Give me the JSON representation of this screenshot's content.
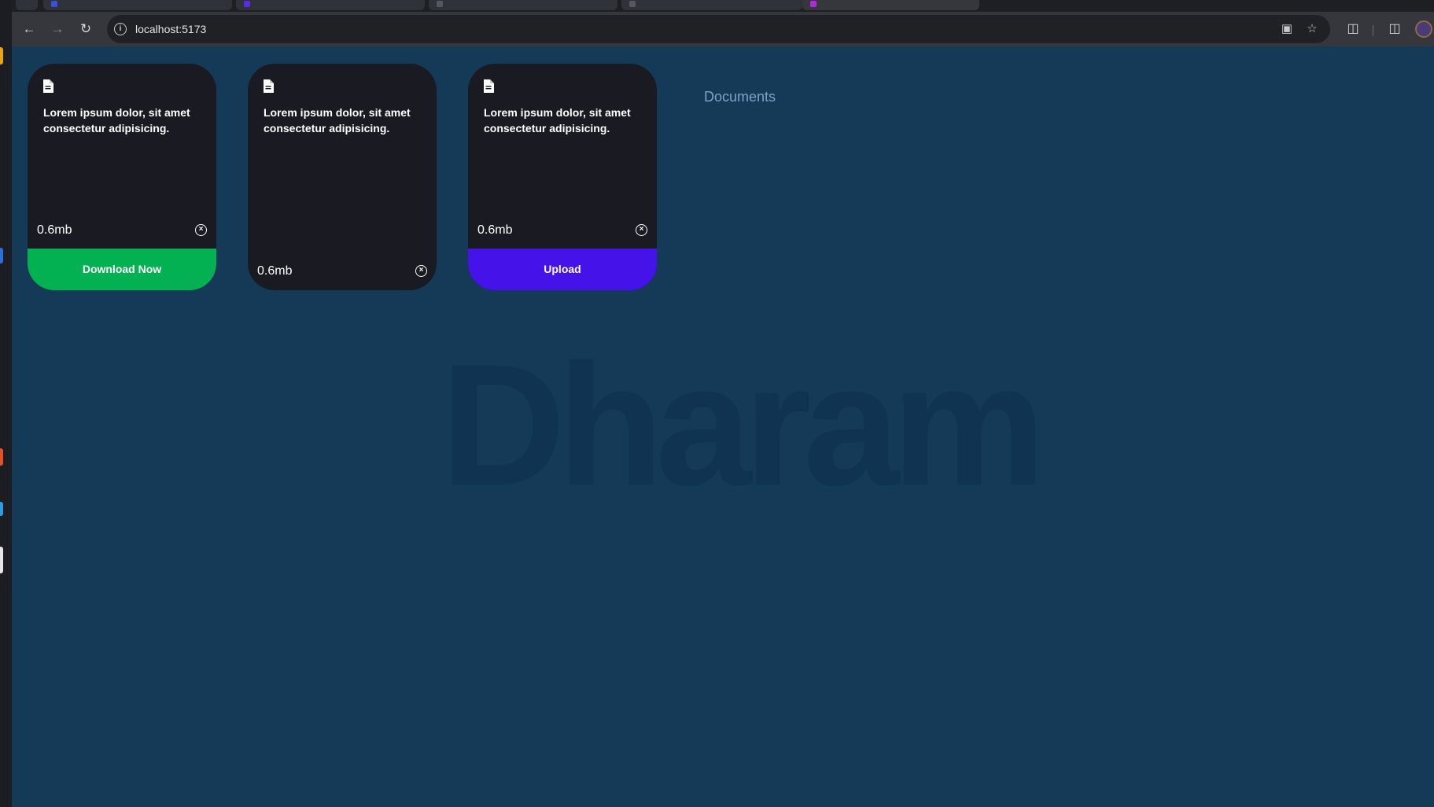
{
  "browser": {
    "url": "localhost:5173"
  },
  "page": {
    "documents_label": "Documents",
    "watermark": "Dharam"
  },
  "cards": [
    {
      "title": "Lorem ipsum dolor, sit amet consectetur adipisicing.",
      "size": "0.6mb",
      "action_label": "Download Now",
      "action_color": "#03b152"
    },
    {
      "title": "Lorem ipsum dolor, sit amet consectetur adipisicing.",
      "size": "0.6mb"
    },
    {
      "title": "Lorem ipsum dolor, sit amet consectetur adipisicing.",
      "size": "0.6mb",
      "action_label": "Upload",
      "action_color": "#4512ea"
    }
  ],
  "icons": {
    "card": "document-icon",
    "remove": "close-circle-icon"
  }
}
